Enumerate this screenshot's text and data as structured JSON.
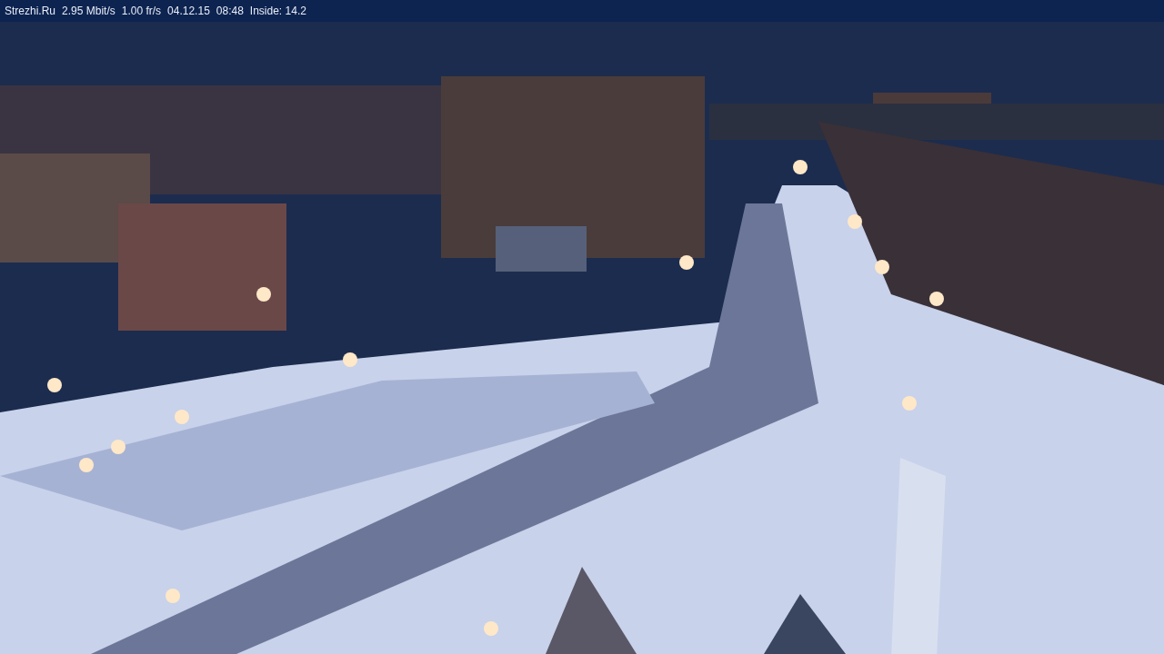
{
  "status_bar": {
    "items": [
      "Strezhi.Ru",
      "2.95 Mbit/s",
      "1.00 fr/s",
      "04.12.15",
      "08:48",
      "Inside: 14.2"
    ]
  }
}
